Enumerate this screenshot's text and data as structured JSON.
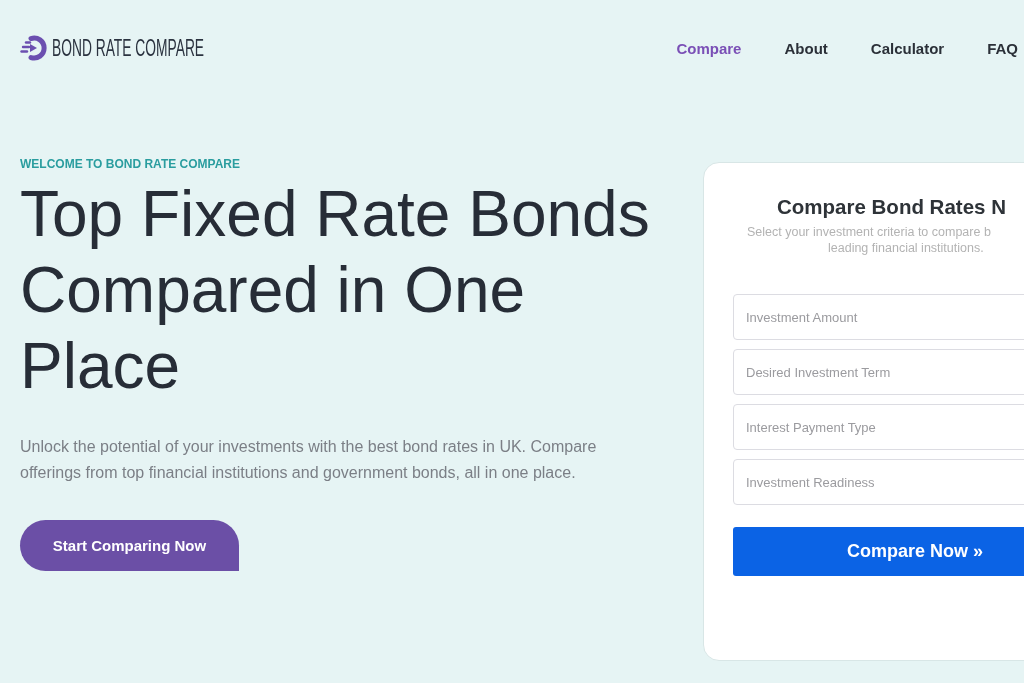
{
  "header": {
    "logo": {
      "text": "BOND RATE COMPARE"
    },
    "nav": [
      {
        "label": "Compare",
        "selected": true
      },
      {
        "label": "About",
        "selected": false
      },
      {
        "label": "Calculator",
        "selected": false
      },
      {
        "label": "FAQ",
        "selected": false
      }
    ]
  },
  "hero": {
    "eyebrow": "WELCOME TO BOND RATE COMPARE",
    "title": "Top Fixed Rate Bonds Compared in One Place",
    "description": "Unlock the potential of your investments with the best bond rates in UK. Compare offerings from top financial institutions and government bonds, all in one place.",
    "button": "Start Comparing Now"
  },
  "form_card": {
    "title": "Compare Bond Rates N",
    "subtitle_lines": [
      "Select your investment criteria to compare b",
      "leading financial institutions."
    ],
    "fields": [
      {
        "placeholder": "Investment Amount"
      },
      {
        "placeholder": "Desired Investment Term"
      },
      {
        "placeholder": "Interest Payment Type"
      },
      {
        "placeholder": "Investment Readiness"
      }
    ],
    "submit": "Compare Now »"
  }
}
